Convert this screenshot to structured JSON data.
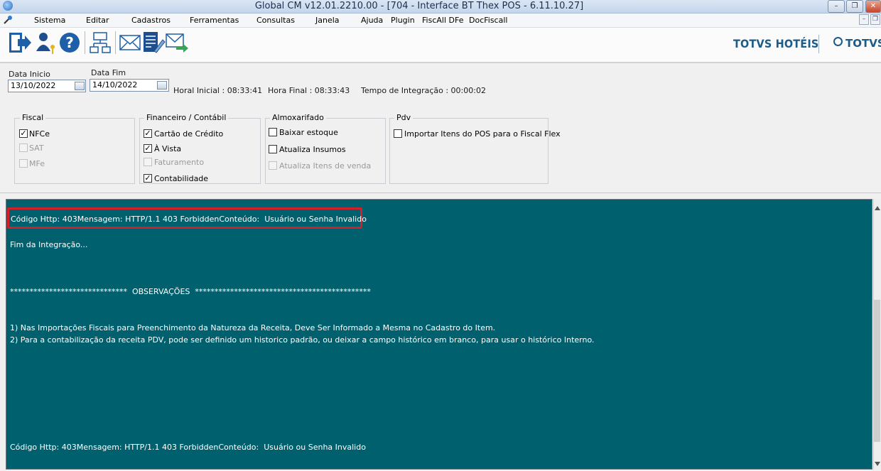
{
  "window": {
    "title": "Global CM v12.01.2210.00 - [704 - Interface BT Thex POS - 6.11.10.27]",
    "controls": {
      "minimize": "–",
      "restore": "❐",
      "close": "✕"
    },
    "mdi_controls": {
      "minimize": "–",
      "restore": "❐"
    }
  },
  "menu": [
    "Sistema",
    "Editar",
    "Cadastros",
    "Ferramentas",
    "Consultas",
    "Janela",
    "Ajuda",
    "Plugin",
    "FiscAll DFe",
    "DocFiscall"
  ],
  "toolbar": {
    "icons": [
      "exit-icon",
      "user-key-icon",
      "help-icon",
      "network-icon",
      "mail-icon",
      "document-edit-icon",
      "mail-send-icon"
    ]
  },
  "brand": {
    "hoteis": "TOTVS HOTÉIS",
    "totvs": "TOTVS"
  },
  "dates": {
    "inicio_label": "Data Inicio",
    "inicio_value": "13/10/2022",
    "fim_label": "Data Fim",
    "fim_value": "14/10/2022"
  },
  "times": {
    "hora_inicial": "Horal Inicial : 08:33:41",
    "hora_final": "Hora Final : 08:33:43",
    "tempo": "Tempo de Integração : 00:00:02"
  },
  "groups": {
    "fiscal": {
      "title": "Fiscal",
      "items": [
        {
          "label": "NFCe",
          "checked": true,
          "enabled": true
        },
        {
          "label": "SAT",
          "checked": false,
          "enabled": false
        },
        {
          "label": "MFe",
          "checked": false,
          "enabled": false
        }
      ]
    },
    "financeiro": {
      "title": "Financeiro / Contábil",
      "items": [
        {
          "label": "Cartão de Crédito",
          "checked": true,
          "enabled": true
        },
        {
          "label": "À Vista",
          "checked": true,
          "enabled": true
        },
        {
          "label": "Faturamento",
          "checked": false,
          "enabled": false
        },
        {
          "label": "Contabilidade",
          "checked": true,
          "enabled": true
        }
      ]
    },
    "almoxarifado": {
      "title": "Almoxarifado",
      "items": [
        {
          "label": "Baixar estoque",
          "checked": false,
          "enabled": true
        },
        {
          "label": "Atualiza Insumos",
          "checked": false,
          "enabled": true
        },
        {
          "label": "Atualiza Itens de venda",
          "checked": false,
          "enabled": false
        }
      ]
    },
    "pdv": {
      "title": "Pdv",
      "items": [
        {
          "label": "Importar Itens do POS para o Fiscal Flex",
          "checked": false,
          "enabled": true
        }
      ]
    }
  },
  "log": {
    "error_top": "Código Http: 403Mensagem: HTTP/1.1 403 ForbiddenConteúdo:  Usuário ou Senha Invalido",
    "fim": "Fim da Integração...",
    "obs_header": "******************************  OBSERVAÇÕES  *********************************************",
    "obs_1": "1) Nas Importações Fiscais para Preenchimento da Natureza da Receita, Deve Ser Informado a Mesma no Cadastro do Item.",
    "obs_2": "2) Para a contabilização da receita PDV, pode ser definido um historico padrão, ou deixar a campo histórico em branco, para usar o histórico Interno.",
    "error_bottom": "Código Http: 403Mensagem: HTTP/1.1 403 ForbiddenConteúdo:  Usuário ou Senha Invalido"
  },
  "colors": {
    "log_background": "#00606d",
    "highlight": "#d1202a",
    "brand": "#1b5c88"
  }
}
